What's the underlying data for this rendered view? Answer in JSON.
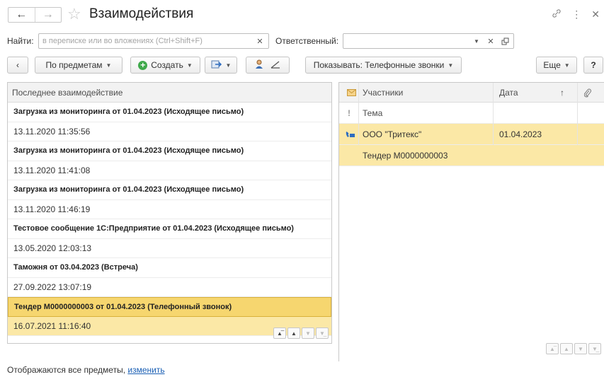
{
  "window": {
    "title": "Взаимодействия"
  },
  "search": {
    "find_label": "Найти:",
    "find_placeholder": "в переписке или во вложениях (Ctrl+Shift+F)",
    "responsible_label": "Ответственный:",
    "responsible_value": ""
  },
  "toolbar": {
    "by_subjects_label": "По предметам",
    "create_label": "Создать",
    "show_label": "Показывать: Телефонные звонки",
    "more_label": "Еще",
    "help_label": "?"
  },
  "left_table": {
    "header": "Последнее взаимодействие",
    "rows": [
      {
        "subject": "Загрузка из мониторинга от 01.04.2023 (Исходящее письмо)",
        "date": "13.11.2020 11:35:56"
      },
      {
        "subject": "Загрузка из мониторинга от 01.04.2023 (Исходящее письмо)",
        "date": "13.11.2020 11:41:08"
      },
      {
        "subject": "Загрузка из мониторинга от 01.04.2023 (Исходящее письмо)",
        "date": "13.11.2020 11:46:19"
      },
      {
        "subject": "Тестовое сообщение 1С:Предприятие от 01.04.2023 (Исходящее письмо)",
        "date": "13.05.2020 12:03:13"
      },
      {
        "subject": "Таможня от 03.04.2023 (Встреча)",
        "date": "27.09.2022 13:07:19"
      },
      {
        "subject": "Тендер М0000000003 от 01.04.2023 (Телефонный звонок)",
        "date": "16.07.2021 11:16:40"
      }
    ],
    "selected_index": 5
  },
  "right_table": {
    "headers": {
      "participants": "Участники",
      "date": "Дата",
      "sort_marker": "↑",
      "topic": "Тема",
      "importance_icon": "!"
    },
    "rows": [
      {
        "participants": "ООО \"Тритекс\"",
        "date": "01.04.2023",
        "topic": "Тендер М0000000003",
        "type_icon": "phone-call-icon"
      }
    ]
  },
  "footer": {
    "text": "Отображаются все предметы, ",
    "link": "изменить"
  },
  "colors": {
    "selection": "#fbe8a6",
    "selection_strong": "#f6d66f",
    "create_icon": "#3fa94b",
    "link": "#1a5fb4"
  }
}
